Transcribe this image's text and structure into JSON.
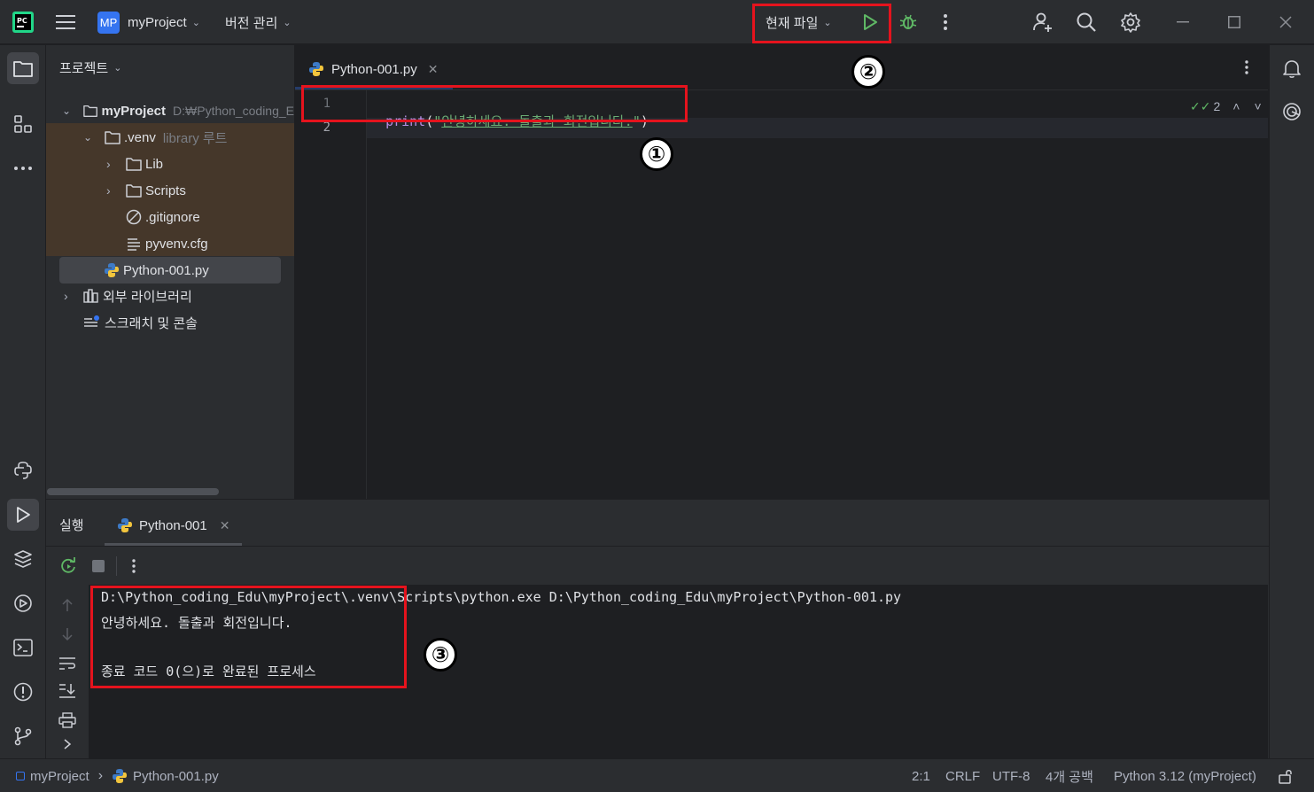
{
  "titlebar": {
    "project_badge": "MP",
    "project_name": "myProject",
    "vcs_menu": "버전 관리",
    "run_config": "현재 파일"
  },
  "project_panel": {
    "title": "프로젝트",
    "tree": {
      "root_name": "myProject",
      "root_path": "D:₩Python_coding_E",
      "venv_name": ".venv",
      "venv_tag": "library 루트",
      "lib": "Lib",
      "scripts": "Scripts",
      "gitignore": ".gitignore",
      "pyvenv": "pyvenv.cfg",
      "python_file": "Python-001.py",
      "external_libs": "외부 라이브러리",
      "scratches": "스크래치 및 콘솔"
    }
  },
  "editor": {
    "tab_label": "Python-001.py",
    "line_numbers": [
      "1",
      "2"
    ],
    "code": {
      "func": "print",
      "open": "(\"",
      "string": "안녕하세요. 돌출과 회전입니다.",
      "close_quote": "\"",
      "close": ")"
    },
    "inspection_count": "2"
  },
  "run_panel": {
    "title": "실행",
    "tab_label": "Python-001",
    "output": [
      "D:\\Python_coding_Edu\\myProject\\.venv\\Scripts\\python.exe D:\\Python_coding_Edu\\myProject\\Python-001.py",
      "안녕하세요. 돌출과 회전입니다.",
      "",
      "종료 코드 0(으)로 완료된 프로세스"
    ]
  },
  "statusbar": {
    "project": "myProject",
    "file": "Python-001.py",
    "position": "2:1",
    "line_sep": "CRLF",
    "encoding": "UTF-8",
    "indent": "4개 공백",
    "interpreter": "Python 3.12 (myProject)"
  },
  "annotations": {
    "one": "①",
    "two": "②",
    "three": "③"
  },
  "colors": {
    "run_green": "#5fb865",
    "annotation_red": "#e5131d",
    "string_green": "#6aab73",
    "keyword_purple": "#b58ee3"
  }
}
